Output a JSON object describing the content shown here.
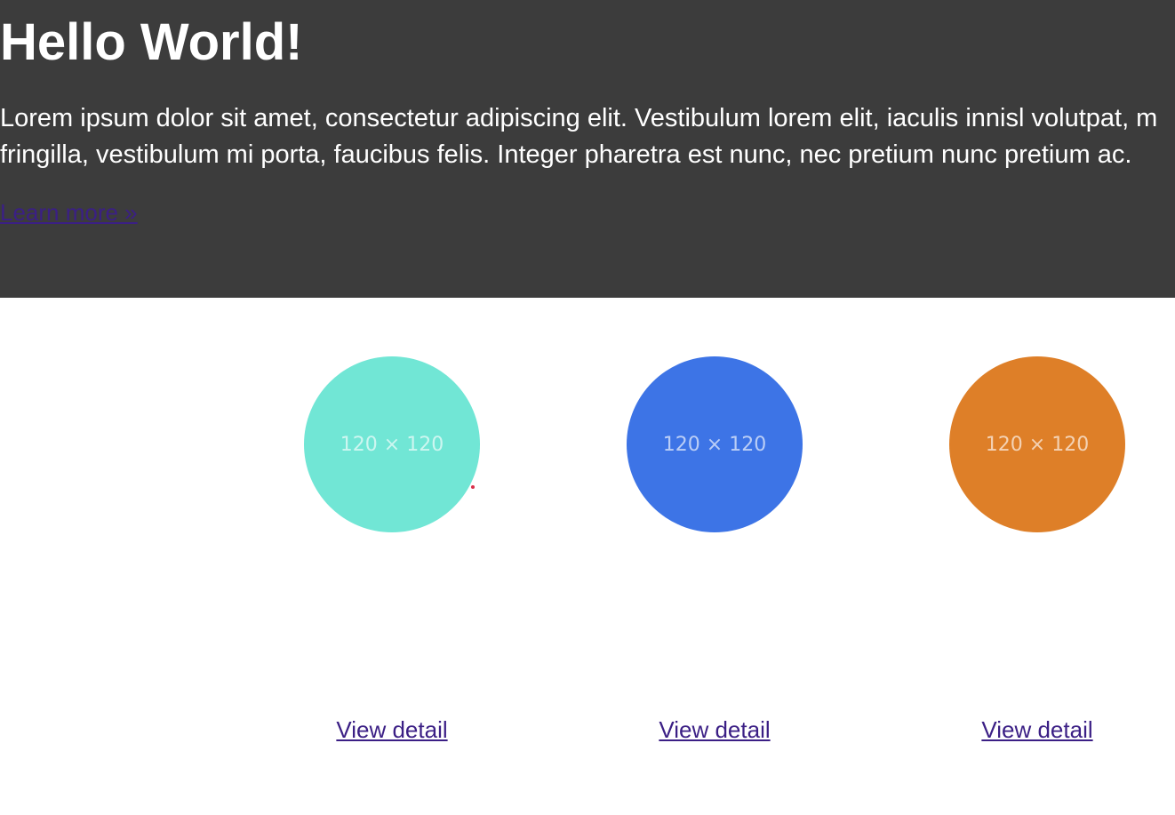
{
  "hero": {
    "title": "Hello World!",
    "lines": [
      "Lorem ipsum dolor sit amet, consectetur adipiscing elit. Vestibulum lorem elit, iaculis innisl volutpat, m",
      "fringilla, vestibulum mi porta, faucibus felis. Integer pharetra est nunc, nec pretium nunc pretium ac."
    ],
    "link_label": "Learn more »",
    "background": "#3c3c3c"
  },
  "cards": [
    {
      "placeholder": "120 × 120",
      "color": "#71e6d5",
      "link_label": "View detail"
    },
    {
      "placeholder": "120 × 120",
      "color": "#3d74e6",
      "link_label": "View detail"
    },
    {
      "placeholder": "120 × 120",
      "color": "#de7f28",
      "link_label": "View detail"
    }
  ],
  "link_color": "#3b1f85"
}
